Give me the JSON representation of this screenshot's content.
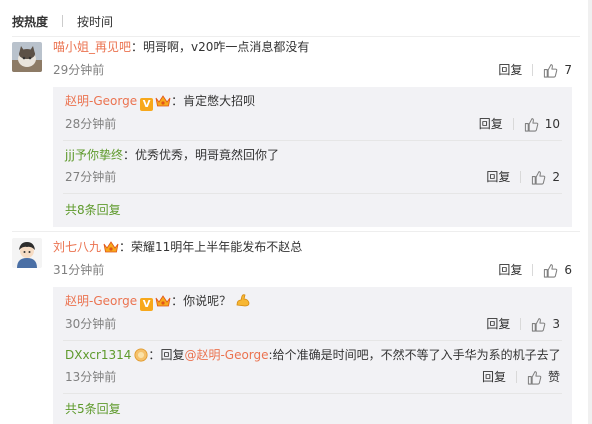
{
  "sort": {
    "hot": "按热度",
    "time": "按时间"
  },
  "comments": [
    {
      "user": "喵小姐_再见吧",
      "text": "明哥啊，v20咋一点消息都没有",
      "time": "29分钟前",
      "reply_label": "回复",
      "likes": "7",
      "replies": [
        {
          "user": "赵明-George",
          "text": "肯定憋大招呗",
          "time": "28分钟前",
          "reply_label": "回复",
          "likes": "10"
        },
        {
          "user": "jjj予你挚终",
          "text": "优秀优秀，明哥竟然回你了",
          "time": "27分钟前",
          "reply_label": "回复",
          "likes": "2"
        }
      ],
      "more": "共8条回复"
    },
    {
      "user": "刘七八九",
      "text": "荣耀11明年上半年能发布不赵总",
      "time": "31分钟前",
      "reply_label": "回复",
      "likes": "6",
      "replies": [
        {
          "user": "赵明-George",
          "text": "你说呢？",
          "time": "30分钟前",
          "reply_label": "回复",
          "likes": "3"
        },
        {
          "user": "DXxcr1314",
          "reply_prefix": "回复",
          "mention": "@赵明-George",
          "text": ":给个准确是时间吧，不然不等了入手华为系的机子去了",
          "time": "13分钟前",
          "reply_label": "回复",
          "likes": "赞"
        }
      ],
      "more": "共5条回复"
    }
  ],
  "colors": {
    "username": "#eb7350",
    "more_link": "#5e9a2c",
    "reply_bg": "#f2f2f5",
    "badge": "#f7a81b"
  },
  "icons": {
    "like": "thumbs-up-icon",
    "verified": "verified-v-icon",
    "vip": "vip-crown-icon"
  }
}
